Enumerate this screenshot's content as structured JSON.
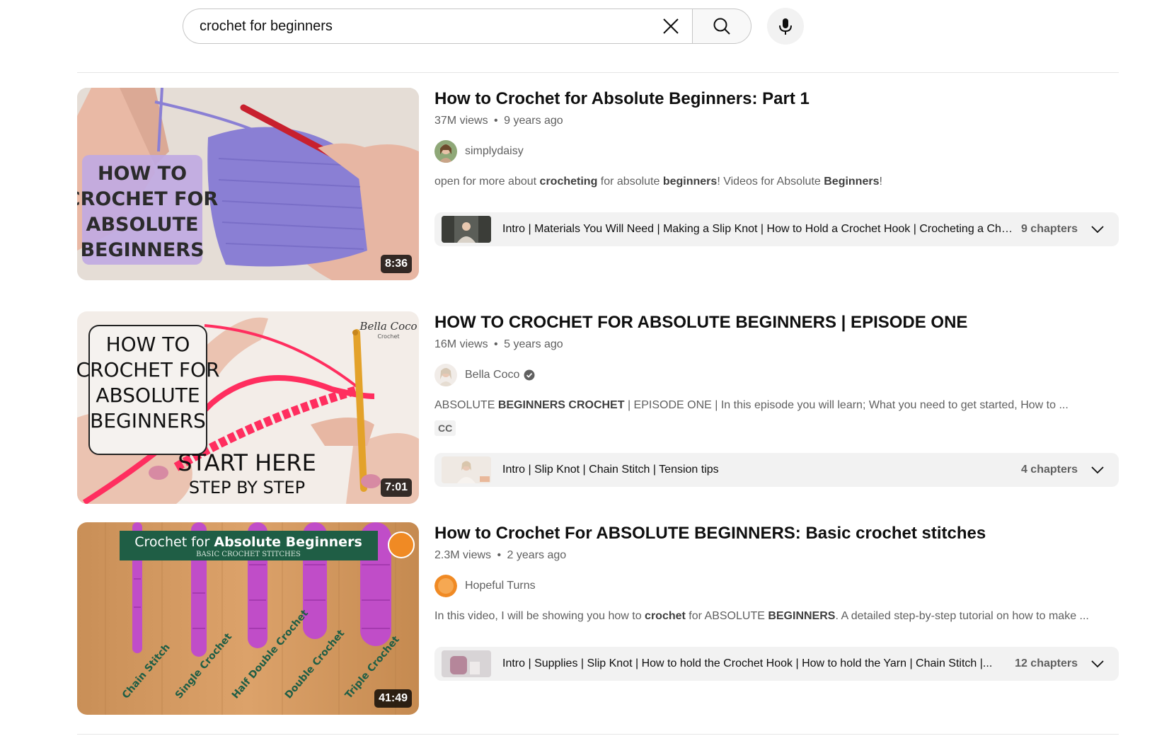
{
  "search": {
    "query": "crochet for beginners"
  },
  "results": [
    {
      "title": "How to Crochet for Absolute Beginners: Part 1",
      "views": "37M views",
      "age": "9 years ago",
      "separator": "•",
      "channel": "simplydaisy",
      "verified": false,
      "desc_parts": [
        {
          "t": "open for more about ",
          "b": false
        },
        {
          "t": "crocheting",
          "b": true
        },
        {
          "t": " for absolute ",
          "b": false
        },
        {
          "t": "beginners",
          "b": true
        },
        {
          "t": "! Videos for Absolute ",
          "b": false
        },
        {
          "t": "Beginners",
          "b": true
        },
        {
          "t": "!",
          "b": false
        }
      ],
      "duration": "8:36",
      "thumb_text": [
        "HOW TO",
        "CROCHET FOR",
        "ABSOLUTE",
        "BEGINNERS"
      ],
      "chapters_text": "Intro | Materials You Will Need | Making a Slip Knot | How to Hold a Crochet Hook | Crocheting a Cha...",
      "chapters_count": "9 chapters"
    },
    {
      "title": "HOW TO CROCHET FOR ABSOLUTE BEGINNERS | EPISODE ONE",
      "views": "16M views",
      "age": "5 years ago",
      "separator": "•",
      "channel": "Bella Coco",
      "verified": true,
      "desc_parts": [
        {
          "t": "ABSOLUTE ",
          "b": false
        },
        {
          "t": "BEGINNERS CROCHET",
          "b": true
        },
        {
          "t": " | EPISODE ONE | In this episode you will learn; What you need to get started, How to ...",
          "b": false
        }
      ],
      "badge": "CC",
      "duration": "7:01",
      "thumb_text": [
        "HOW TO",
        "CROCHET FOR",
        "ABSOLUTE",
        "BEGINNERS"
      ],
      "thumb_sub": [
        "START HERE",
        "STEP BY STEP"
      ],
      "thumb_logo": "Bella Coco",
      "thumb_logo_sub": "Crochet",
      "chapters_text": "Intro | Slip Knot | Chain Stitch | Tension tips",
      "chapters_count": "4 chapters"
    },
    {
      "title": "How to Crochet For ABSOLUTE BEGINNERS: Basic crochet stitches",
      "views": "2.3M views",
      "age": "2 years ago",
      "separator": "•",
      "channel": "Hopeful Turns",
      "verified": false,
      "desc_parts": [
        {
          "t": "In this video, I will be showing you how to ",
          "b": false
        },
        {
          "t": "crochet",
          "b": true
        },
        {
          "t": " for ABSOLUTE ",
          "b": false
        },
        {
          "t": "BEGINNERS",
          "b": true
        },
        {
          "t": ". A detailed step-by-step tutorial on how to make ...",
          "b": false
        }
      ],
      "duration": "41:49",
      "thumb_banner": "Crochet for",
      "thumb_banner_bold": "Absolute Beginners",
      "thumb_banner_sub": "BASIC CROCHET STITCHES",
      "thumb_stitches": [
        "Chain Stitch",
        "Single Crochet",
        "Half Double Crochet",
        "Double Crochet",
        "Triple Crochet"
      ],
      "chapters_text": "Intro | Supplies | Slip Knot | How to hold the Crochet Hook | How to hold the Yarn | Chain Stitch |...",
      "chapters_count": "12 chapters"
    }
  ],
  "colors": {
    "purple_yarn": "#8a7fd4",
    "pink_yarn": "#ff2e5f",
    "magenta_yarn": "#c04dc8",
    "banner_green": "#1f5e45"
  }
}
